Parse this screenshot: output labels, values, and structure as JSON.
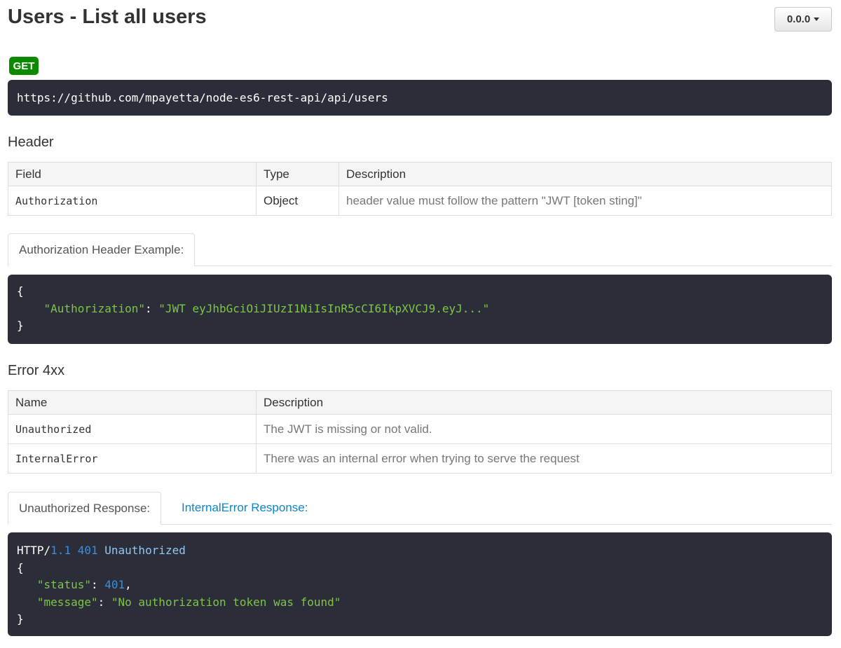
{
  "page": {
    "title": "Users - List all users",
    "version": "0.0.0"
  },
  "request": {
    "method": "GET",
    "url": "https://github.com/mpayetta/node-es6-rest-api/api/users"
  },
  "header_section": {
    "title": "Header",
    "columns": [
      "Field",
      "Type",
      "Description"
    ],
    "rows": [
      {
        "field": "Authorization",
        "type": "Object",
        "description": "header value must follow the pattern \"JWT [token sting]\""
      }
    ]
  },
  "header_example": {
    "tab_label": "Authorization Header Example:",
    "open_brace": "{",
    "key": "\"Authorization\"",
    "colon": ": ",
    "value": "\"JWT eyJhbGciOiJIUzI1NiIsInR5cCI6IkpXVCJ9.eyJ...\"",
    "close_brace": "}"
  },
  "error_section": {
    "title": "Error 4xx",
    "columns": [
      "Name",
      "Description"
    ],
    "rows": [
      {
        "name": "Unauthorized",
        "description": "The JWT is missing or not valid."
      },
      {
        "name": "InternalError",
        "description": "There was an internal error when trying to serve the request"
      }
    ]
  },
  "error_responses": {
    "tabs": [
      {
        "label": "Unauthorized Response:",
        "active": true
      },
      {
        "label": "InternalError Response:",
        "active": false
      }
    ],
    "code": {
      "http_prefix": "HTTP/",
      "http_version": "1.1",
      "status_code": "401",
      "status_text": "Unauthorized",
      "open_brace": "{",
      "status_key": "\"status\"",
      "status_value": "401",
      "message_key": "\"message\"",
      "message_value": "\"No authorization token was found\"",
      "close_brace": "}"
    }
  },
  "colors": {
    "method_badge": "#0b8a00",
    "code_background": "#2b2d38",
    "link": "#0a86c8",
    "json_string": "#7ec54a",
    "json_number": "#3b8fdc"
  }
}
